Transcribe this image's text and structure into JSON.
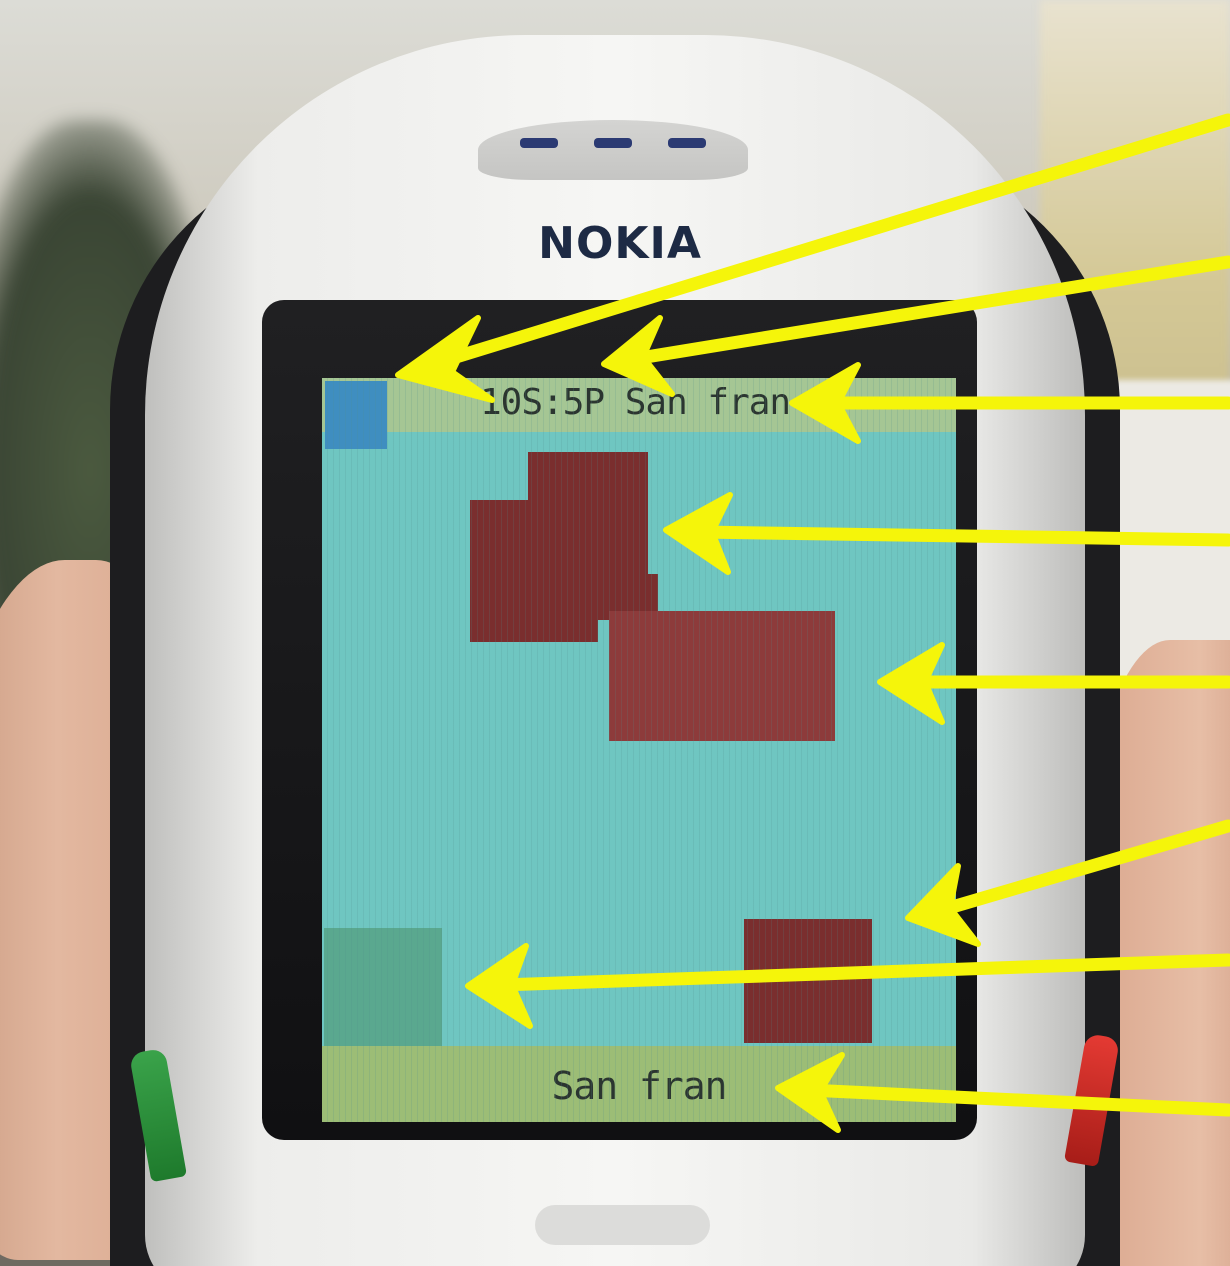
{
  "phone": {
    "brand_logo": "NOKIA"
  },
  "screen": {
    "status_text": "10S:5P San fran",
    "bottom_text": "San fran"
  },
  "colors": {
    "arrow": "#f5f50a",
    "screen_background": "#6fc6c1",
    "status_bar": "#a5c694",
    "blocks": "#7a2e2e",
    "indicator": "#3f8ec0"
  },
  "annotations": {
    "arrow_count": 8
  }
}
